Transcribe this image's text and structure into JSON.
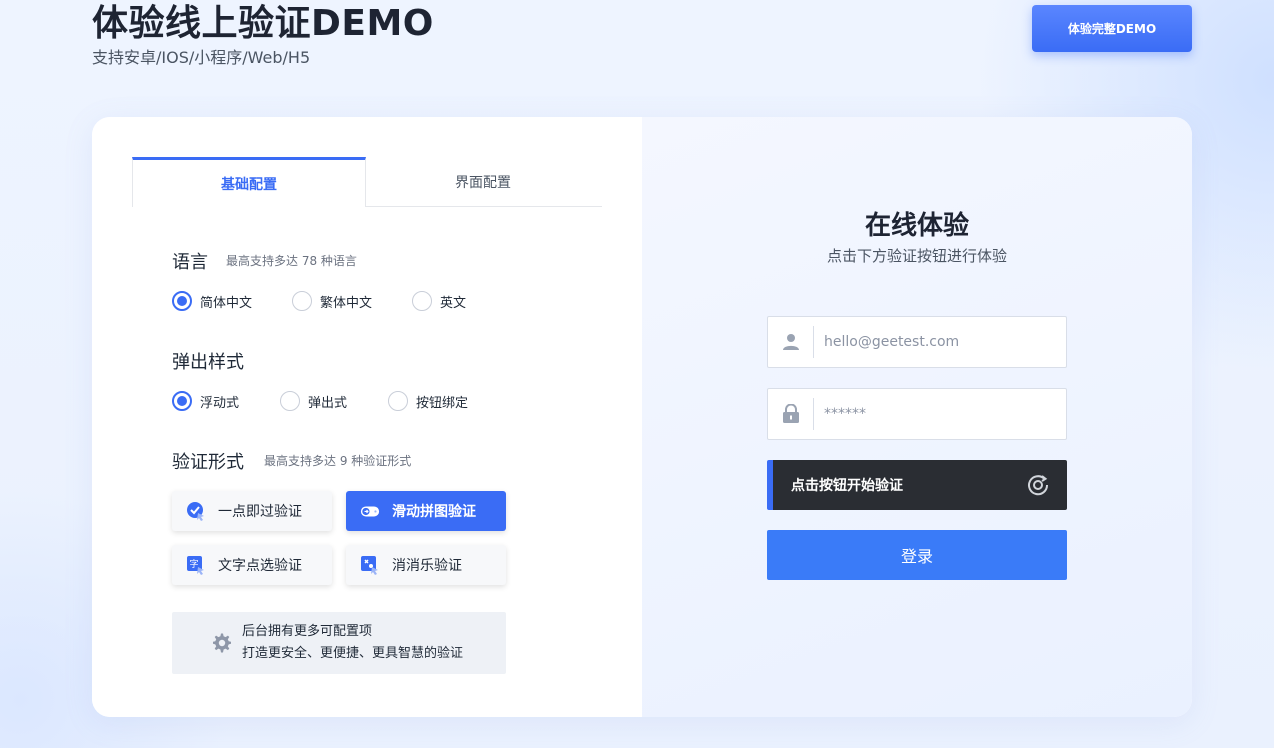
{
  "header": {
    "title": "体验线上验证DEMO",
    "subtitle": "支持安卓/IOS/小程序/Web/H5",
    "full_demo_label": "体验完整DEMO"
  },
  "tabs": [
    {
      "label": "基础配置",
      "active": true
    },
    {
      "label": "界面配置",
      "active": false
    }
  ],
  "language": {
    "title": "语言",
    "note": "最高支持多达 78 种语言",
    "options": [
      {
        "label": "简体中文",
        "checked": true
      },
      {
        "label": "繁体中文",
        "checked": false
      },
      {
        "label": "英文",
        "checked": false
      }
    ]
  },
  "popup_style": {
    "title": "弹出样式",
    "options": [
      {
        "label": "浮动式",
        "checked": true
      },
      {
        "label": "弹出式",
        "checked": false
      },
      {
        "label": "按钮绑定",
        "checked": false
      }
    ]
  },
  "verify_form": {
    "title": "验证形式",
    "note": "最高支持多达 9 种验证形式",
    "options": [
      {
        "label": "一点即过验证",
        "icon": "click-check-icon",
        "selected": false
      },
      {
        "label": "滑动拼图验证",
        "icon": "slide-puzzle-icon",
        "selected": true
      },
      {
        "label": "文字点选验证",
        "icon": "text-select-icon",
        "selected": false
      },
      {
        "label": "消消乐验证",
        "icon": "match-game-icon",
        "selected": false
      }
    ]
  },
  "more_config": {
    "icon": "gear-icon",
    "line1": "后台拥有更多可配置项",
    "line2": "打造更安全、更便捷、更具智慧的验证"
  },
  "online": {
    "title": "在线体验",
    "subtitle": "点击下方验证按钮进行体验",
    "username_placeholder": "hello@geetest.com",
    "password_placeholder": "******",
    "captcha_label": "点击按钮开始验证",
    "login_label": "登录"
  },
  "colors": {
    "accent": "#3a6cf5",
    "login": "#3a7bf8",
    "captcha_bg": "#2a2d33"
  }
}
